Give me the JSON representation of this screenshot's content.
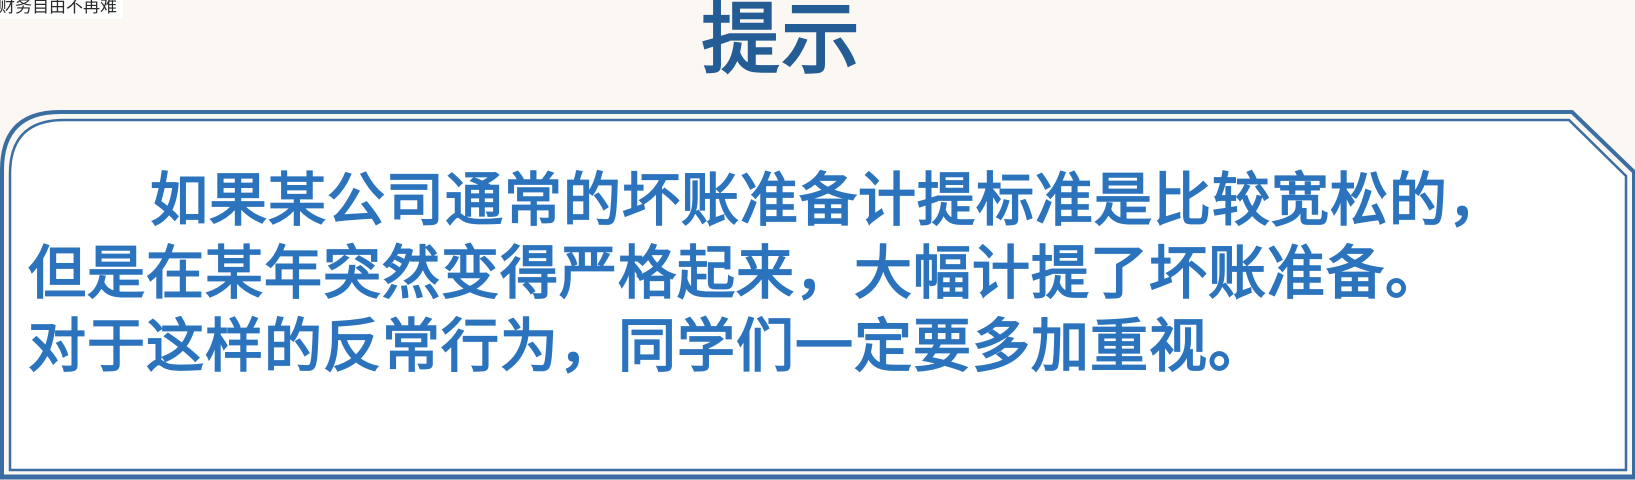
{
  "corner_caption": "财务自由不再难",
  "title": "提示",
  "body": {
    "lines": [
      "如果某公司通常的坏账准备计提标准是比较宽松的，",
      "但是在某年突然变得严格起来，大幅计提了坏账准备。",
      "对于这样的反常行为，同学们一定要多加重视。"
    ]
  },
  "colors": {
    "background": "#fbf7f2",
    "title": "#245d95",
    "body_text": "#2b74bd",
    "frame_border": "#3a6ea3",
    "panel": "#ffffff"
  }
}
